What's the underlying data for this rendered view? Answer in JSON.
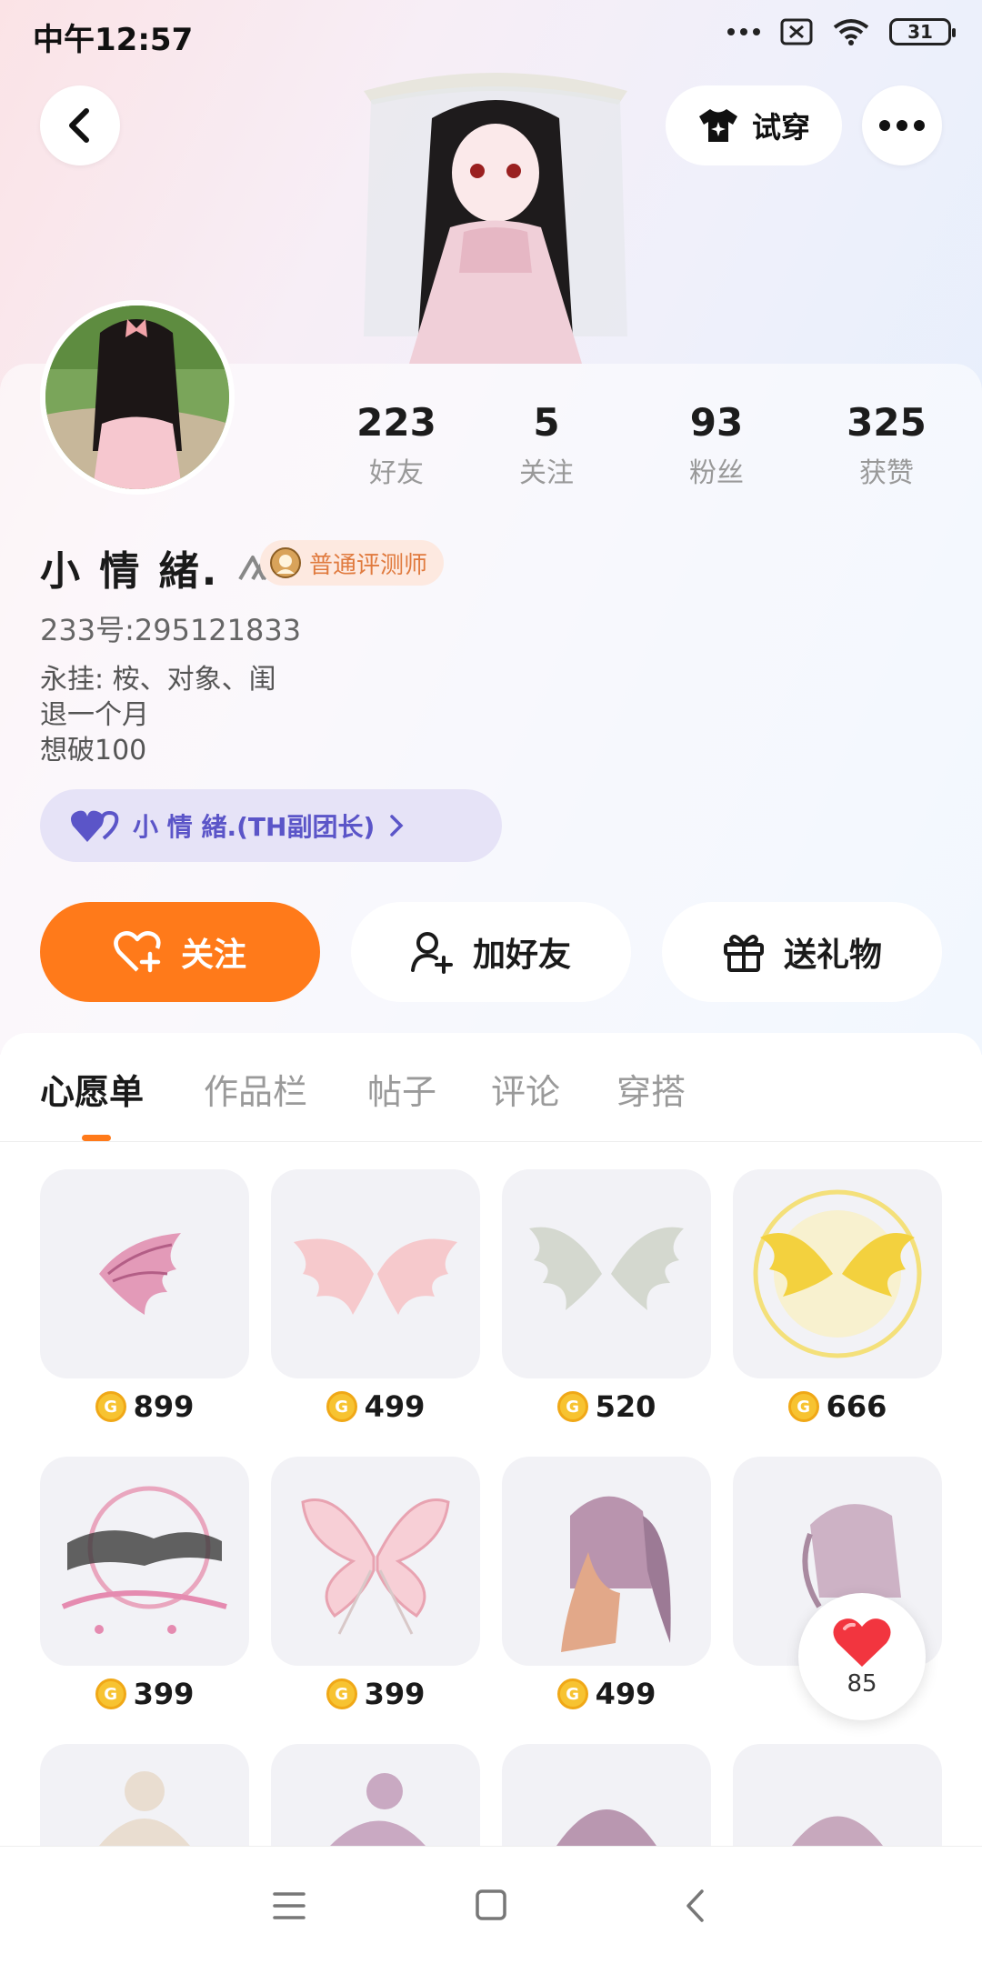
{
  "status_bar": {
    "time": "中午12:57",
    "battery": "31"
  },
  "top_bar": {
    "try_on_label": "试穿"
  },
  "profile": {
    "stats": [
      {
        "value": "223",
        "label": "好友"
      },
      {
        "value": "5",
        "label": "关注"
      },
      {
        "value": "93",
        "label": "粉丝"
      },
      {
        "value": "325",
        "label": "获赞"
      }
    ],
    "username": "小 情 緒.",
    "badge": "普通评测师",
    "uid": "233号:295121833",
    "bio_lines": [
      "永挂: 桉、对象、闺",
      "退一个月",
      "想破100"
    ],
    "group_chip": "小 情 緒.(TH副团长)"
  },
  "actions": {
    "follow": "关注",
    "add_friend": "加好友",
    "send_gift": "送礼物"
  },
  "tabs": [
    "心愿单",
    "作品栏",
    "帖子",
    "评论",
    "穿搭"
  ],
  "wishlist": [
    {
      "item": "pink-wing-icon",
      "price": "899"
    },
    {
      "item": "pink-angel-wings-icon",
      "price": "499"
    },
    {
      "item": "grey-dragon-wings-icon",
      "price": "520"
    },
    {
      "item": "golden-wings-icon",
      "price": "666"
    },
    {
      "item": "ink-frame-icon",
      "price": "399"
    },
    {
      "item": "butterfly-wings-icon",
      "price": "399"
    },
    {
      "item": "ponytail-hair-icon",
      "price": "499"
    },
    {
      "item": "short-hair-icon",
      "price": ""
    }
  ],
  "like_fab": {
    "count": "85"
  },
  "colors": {
    "accent": "#ff7a1a",
    "chip_text": "#5b55c8",
    "chip_bg": "#e6e3f7"
  }
}
